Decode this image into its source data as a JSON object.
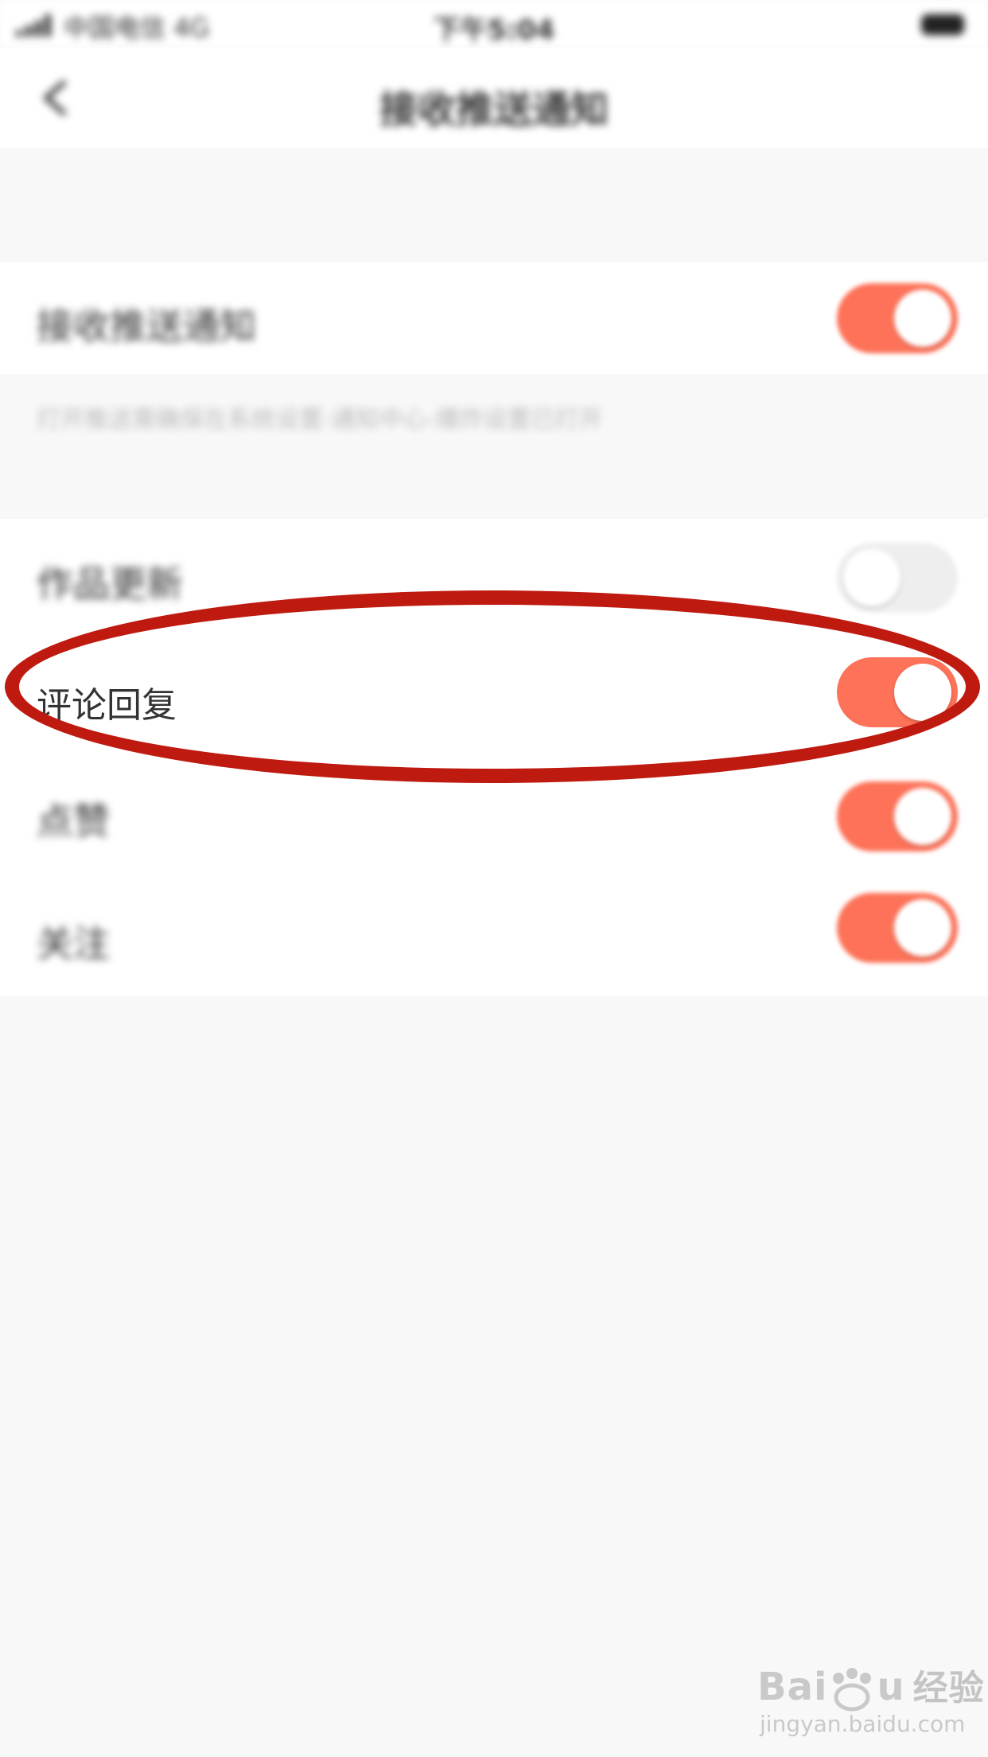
{
  "status_bar": {
    "carrier": "中国电信 4G",
    "time": "下午5:04"
  },
  "nav": {
    "title": "接收推送通知"
  },
  "master_setting": {
    "label": "接收推送通知",
    "enabled": true,
    "hint": "打开推送需确保在系统设置-通知中心-爆炸设置已打开"
  },
  "settings": [
    {
      "label": "作品更新",
      "enabled": false
    },
    {
      "label": "评论回复",
      "enabled": true
    },
    {
      "label": "点赞",
      "enabled": true
    },
    {
      "label": "关注",
      "enabled": true
    }
  ],
  "colors": {
    "toggle_on": "#fd7258",
    "toggle_off": "#eeeeee",
    "annotation": "#bf1a10"
  },
  "watermark": {
    "logo_text": "Bai",
    "logo_text_2": "u",
    "cn_text": "经验",
    "url": "jingyan.baidu.com"
  }
}
